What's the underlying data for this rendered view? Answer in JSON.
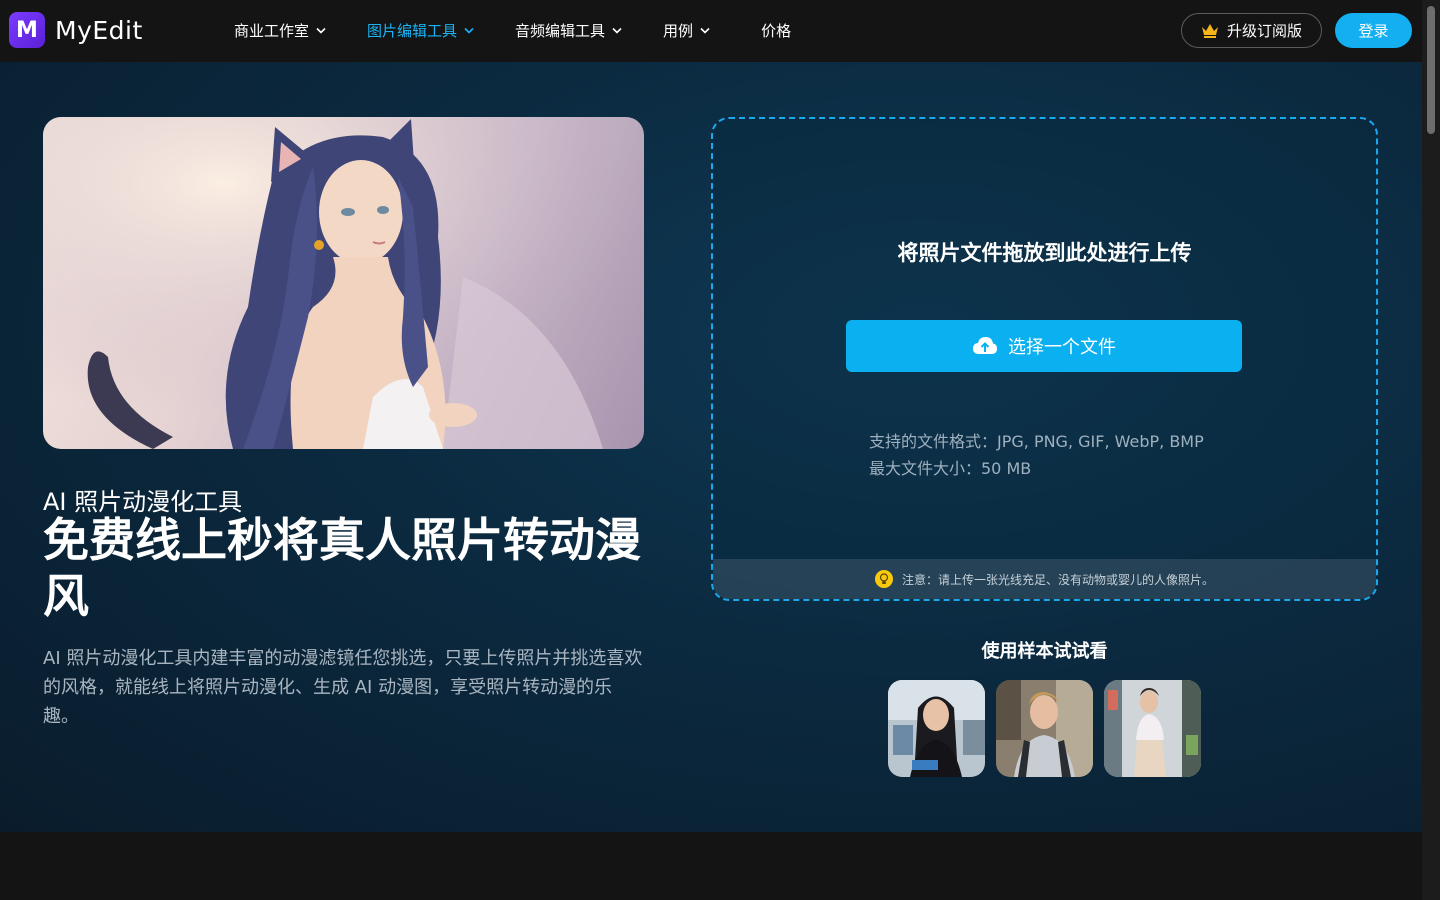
{
  "nav": {
    "logo_text": "MyEdit",
    "logo_letter": "M",
    "menu": [
      {
        "label": "商业工作室",
        "has_dropdown": true,
        "active": false
      },
      {
        "label": "图片编辑工具",
        "has_dropdown": true,
        "active": true
      },
      {
        "label": "音频编辑工具",
        "has_dropdown": true,
        "active": false
      },
      {
        "label": "用例",
        "has_dropdown": true,
        "active": false
      },
      {
        "label": "价格",
        "has_dropdown": false,
        "active": false
      }
    ],
    "upgrade_label": "升级订阅版",
    "login_label": "登录"
  },
  "hero": {
    "subtitle": "AI 照片动漫化工具",
    "headline": "免费线上秒将真人照片转动漫风",
    "description": "AI 照片动漫化工具内建丰富的动漫滤镜任您挑选，只要上传照片并挑选喜欢的风格，就能线上将照片动漫化、生成 AI 动漫图，享受照片转动漫的乐趣。"
  },
  "upload": {
    "title": "将照片文件拖放到此处进行上传",
    "choose_label": "选择一个文件",
    "formats_label": "支持的文件格式：JPG, PNG, GIF, WebP, BMP",
    "max_size_label": "最大文件大小：50 MB",
    "note": "注意：请上传一张光线充足、没有动物或婴儿的人像照片。"
  },
  "samples": {
    "title": "使用样本试试看",
    "items": [
      "sample-woman-office",
      "sample-man-backpack",
      "sample-woman-store"
    ]
  },
  "colors": {
    "accent": "#13aff0",
    "active_menu": "#19b4f6",
    "background": "#141414"
  }
}
